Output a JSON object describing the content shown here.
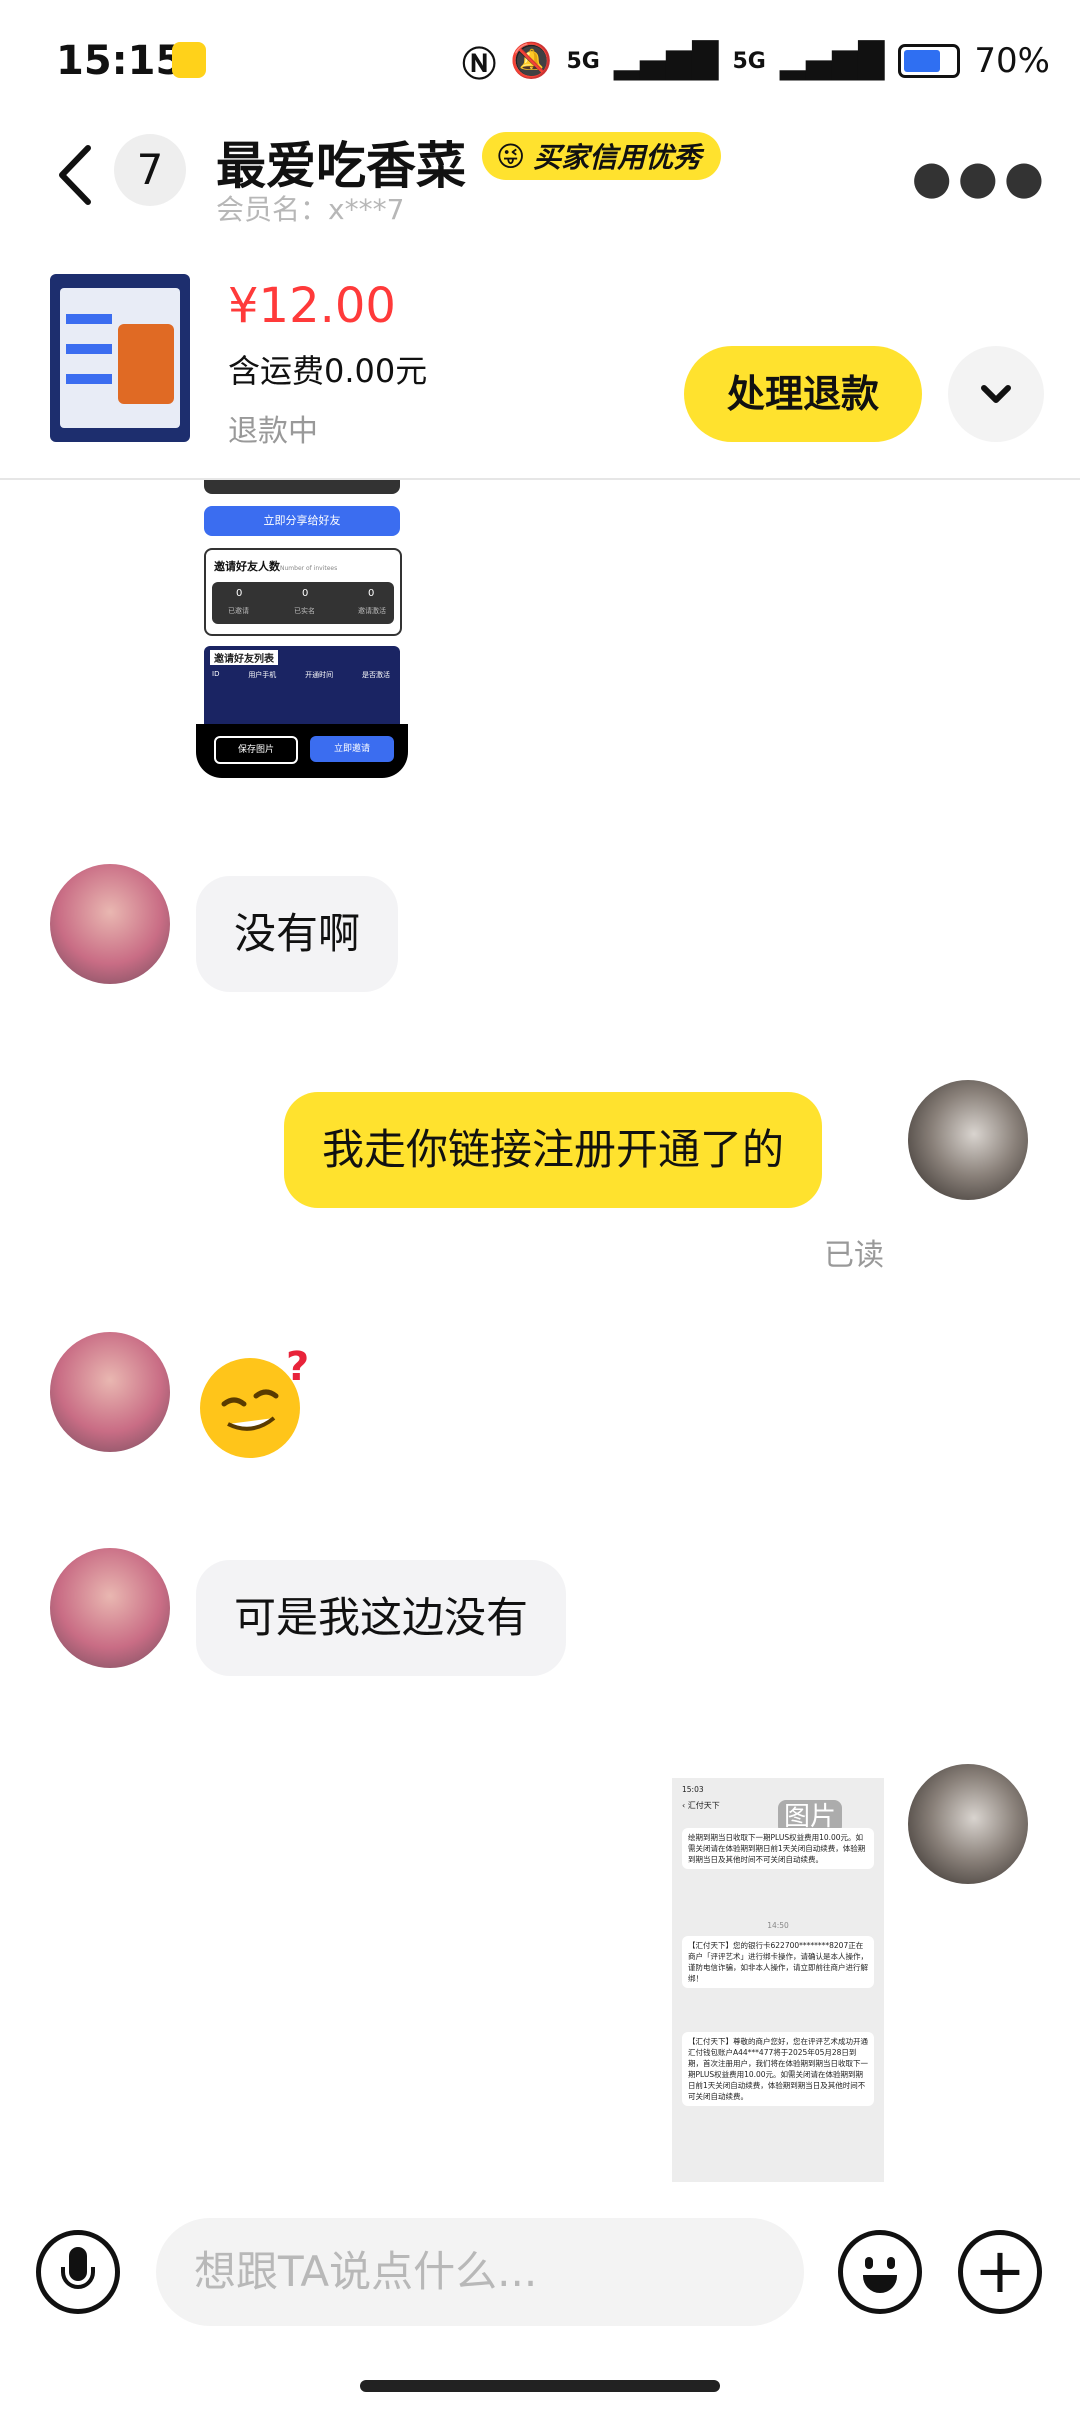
{
  "status_bar": {
    "time": "15:15",
    "network1": "5G",
    "network2": "5G",
    "battery": "70%"
  },
  "header": {
    "unread_count": "7",
    "title": "最爱吃香菜",
    "credit_badge": "买家信用优秀",
    "member": "会员名：x***7"
  },
  "product": {
    "price": "¥12.00",
    "shipping": "含运费0.00元",
    "status": "退款中",
    "refund_button": "处理退款"
  },
  "shared_image_top": {
    "button1": "立即分享给好友",
    "section1": "邀请好友人数",
    "section1_sub": "Number of invitees",
    "counts": [
      "0",
      "0",
      "0"
    ],
    "count_labels": [
      "已邀请",
      "已实名",
      "邀请激活"
    ],
    "section2": "邀请好友列表",
    "cols": [
      "ID",
      "用户手机",
      "开通时间",
      "是否激活"
    ],
    "save_btn": "保存图片",
    "invite_btn": "立即邀请"
  },
  "messages": [
    {
      "side": "in",
      "text": "没有啊"
    },
    {
      "side": "out",
      "text": "我走你链接注册开通了的",
      "read": "已读"
    },
    {
      "side": "in",
      "text": "可是我这边没有"
    }
  ],
  "shared_image_bottom": {
    "label": "图片",
    "time": "15:03",
    "app": "汇付天下",
    "paragraph1": "绘期到期当日收取下一期PLUS权益费用10.00元。如需关闭请在体验期到期日前1天关闭自动续费，体验期到期当日及其他时间不可关闭自动续费。",
    "timestamp": "14:50",
    "paragraph2": "【汇付天下】您的银行卡622700********8207正在商户「评评艺术」进行绑卡操作，请确认是本人操作，谨防电信诈骗，如非本人操作，请立即前往商户进行解绑！",
    "paragraph3": "【汇付天下】尊敬的商户您好，您在评评艺术成功开通汇付钱包账户A44***477将于2025年05月28日到期，首次注册用户，我们将在体验期到期当日收取下一期PLUS权益费用10.00元。如需关闭请在体验期到期日前1天关闭自动续费，体验期到期当日及其他时间不可关闭自动续费。"
  },
  "input": {
    "placeholder": "想跟TA说点什么..."
  },
  "colors": {
    "accent": "#ffe22e",
    "price": "#ff3a3a"
  }
}
